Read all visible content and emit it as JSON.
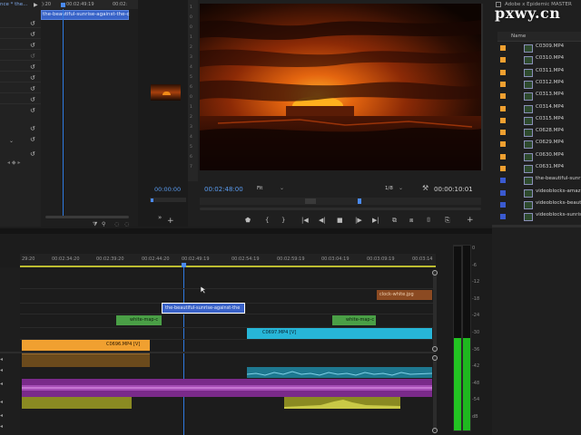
{
  "watermark": "pxwy.cn",
  "source_panel": {
    "tab_title": "nce * the...",
    "clip_label": "the-beautiful-sunrise-against-the-c",
    "ruler": [
      "):20",
      "00:02:49:19",
      "00:02:"
    ],
    "timecode_left": "00:00:00"
  },
  "program_monitor": {
    "timecode": "00:02:48:00",
    "fit": "Fit",
    "resolution": "1/8",
    "duration": "00:00:10:01",
    "left_ruler_nums": [
      "1",
      "0",
      "0",
      "1",
      "2",
      "3",
      "4",
      "5",
      "6",
      "0",
      "1",
      "2",
      "3",
      "4",
      "5",
      "6",
      "7"
    ],
    "transport_icons": [
      "marker-icon",
      "in-point-icon",
      "out-point-icon",
      "go-to-in-icon",
      "step-back-icon",
      "stop-icon",
      "play-icon",
      "step-forward-icon",
      "lift-icon",
      "extract-icon",
      "export-frame-icon",
      "insert-icon",
      "add-icon"
    ]
  },
  "project_panel": {
    "title": "Adobe x Epidemic MASTER",
    "column_name": "Name",
    "items": [
      {
        "name": "C0309.MP4",
        "color": "#f0a030",
        "kind": "video"
      },
      {
        "name": "C0310.MP4",
        "color": "#f0a030",
        "kind": "video"
      },
      {
        "name": "C0311.MP4",
        "color": "#f0a030",
        "kind": "video"
      },
      {
        "name": "C0312.MP4",
        "color": "#f0a030",
        "kind": "video"
      },
      {
        "name": "C0313.MP4",
        "color": "#f0a030",
        "kind": "video"
      },
      {
        "name": "C0314.MP4",
        "color": "#f0a030",
        "kind": "video"
      },
      {
        "name": "C0315.MP4",
        "color": "#f0a030",
        "kind": "video"
      },
      {
        "name": "C0628.MP4",
        "color": "#f0a030",
        "kind": "video"
      },
      {
        "name": "C0629.MP4",
        "color": "#f0a030",
        "kind": "video"
      },
      {
        "name": "C0630.MP4",
        "color": "#f0a030",
        "kind": "video"
      },
      {
        "name": "C0631.MP4",
        "color": "#f0a030",
        "kind": "video"
      },
      {
        "name": "the-beautiful-sunri",
        "color": "#3a5ad0",
        "kind": "video"
      },
      {
        "name": "videoblocks-amaz",
        "color": "#3a5ad0",
        "kind": "video"
      },
      {
        "name": "videoblocks-beaut",
        "color": "#3a5ad0",
        "kind": "video"
      },
      {
        "name": "videoblocks-sunris",
        "color": "#3a5ad0",
        "kind": "video"
      }
    ]
  },
  "timeline": {
    "ruler_labels": [
      "29:20",
      "00:02:34:20",
      "00:02:39:20",
      "00:02:44:20",
      "00:02:49:19",
      "00:02:54:19",
      "00:02:59:19",
      "00:03:04:19",
      "00:03:09:19",
      "00:03:14"
    ],
    "clips": {
      "clock_white": "clock-white.jpg",
      "sunrise": "the-beautiful-sunrise-against-the",
      "white_map_1": "white-map-c",
      "white_map_2": "white-map-c",
      "c0697": "C0697.MP4 [V]",
      "c0696": "C0696.MP4 [V]"
    }
  },
  "audio_meter": {
    "ticks": [
      "0",
      "-6",
      "-12",
      "-18",
      "-24",
      "-30",
      "-36",
      "-42",
      "-48",
      "-54",
      "dB"
    ]
  },
  "colors": {
    "accent_blue": "#4a8af0",
    "playhead": "#2f7ae0",
    "green_meter": "#2bd02b"
  }
}
